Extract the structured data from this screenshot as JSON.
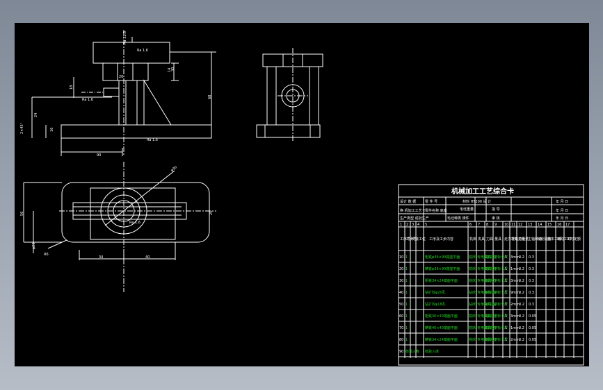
{
  "drawing": {
    "dims": {
      "top_label": "Ra 12.5",
      "ra_top": "Ra 1.6",
      "ra_left": "Ra 1.6",
      "ra_bottom": "Ra 1.6",
      "ra_plan": "Ra 1.6",
      "d30": "30",
      "d14": "14",
      "d68": "68",
      "d90": "90",
      "d24": "24",
      "d16": "16",
      "d18": "18",
      "d2x45": "2×45°",
      "phi20": "φ20",
      "phi36": "φ36",
      "r6": "R6",
      "d34": "34",
      "d40": "40",
      "d56": "56",
      "d20": "20",
      "phi": "φ"
    },
    "card": {
      "title": "机械加工工艺综合卡",
      "row1": [
        "设计 数 据",
        "零 件 号",
        "材料 HT200 设 计",
        "年 月 日"
      ],
      "row2": [
        "换 机加工工艺卡",
        "零件名称 底座",
        "毛坯重量",
        "指 导",
        "年 月 日"
      ],
      "row3": [
        "生产类型 成批生产",
        "毛坯种类 铸件",
        "审 核",
        "年 月 日"
      ],
      "col_numbers": [
        "1",
        "2",
        "3",
        "4",
        "5",
        "6",
        "7",
        "8",
        "9",
        "10",
        "11",
        "12",
        "13",
        "14",
        "15",
        "16",
        "17"
      ],
      "headers": {
        "seq": "工序号",
        "step": "工步号",
        "install": "安装工位",
        "content": "工序及工步内容",
        "machine": "机床",
        "fixture": "夹具",
        "tool": "刀具",
        "gauge": "量具",
        "passes": "走刀次数",
        "speed": "背吃刀量",
        "feed": "进给量",
        "rpm": "主轴转速",
        "cut": "切削速度",
        "time_base": "基本工时",
        "time_aux": "辅助工时",
        "quota": "工时定额"
      },
      "rows": [
        {
          "no": "10",
          "step": "1",
          "content": "粗铣φ36×90底座平面",
          "machine": "铣床",
          "fixture": "专用夹具",
          "tool": "端铣刀",
          "gauge": "游标卡尺",
          "passes": "1",
          "depth": "3mm",
          "feed": "0.2",
          "rpm": "0.3"
        },
        {
          "no": "20",
          "step": "1",
          "content": "精铣φ36×90底座平面",
          "machine": "铣床",
          "fixture": "专用夹具",
          "tool": "端铣刀",
          "gauge": "游标卡尺",
          "passes": "1",
          "depth": "1mm",
          "feed": "0.2",
          "rpm": "0.3"
        },
        {
          "no": "30",
          "step": "1",
          "content": "粗铣34×24端面平面",
          "machine": "铣床",
          "fixture": "专用夹具",
          "tool": "端铣刀",
          "gauge": "游标卡尺",
          "passes": "1",
          "depth": "3mm",
          "feed": "0.2",
          "rpm": "0.3"
        },
        {
          "no": "40",
          "step": "1",
          "content": "钻扩铰φ20孔",
          "machine": "钻床",
          "fixture": "专用夹具",
          "tool": "麻花钻",
          "gauge": "游标卡尺",
          "passes": "1",
          "depth": "9mm",
          "feed": "0.2",
          "rpm": "0.3"
        },
        {
          "no": "50",
          "step": "1",
          "content": "钻扩铰φ18孔",
          "machine": "钻床",
          "fixture": "专用夹具",
          "tool": "麻花钻",
          "gauge": "游标卡尺",
          "passes": "1",
          "depth": "2mm",
          "feed": "0.2",
          "rpm": "0.3"
        },
        {
          "no": "60",
          "step": "1",
          "content": "粗铣30×30端面平面",
          "machine": "铣床",
          "fixture": "专用夹具",
          "tool": "端铣刀",
          "gauge": "游标卡尺",
          "passes": "1",
          "depth": "3mm",
          "feed": "0.2",
          "rpm": "0.05"
        },
        {
          "no": "70",
          "step": "1",
          "content": "精铣40×40端面平面",
          "machine": "铣床",
          "fixture": "专用夹具",
          "tool": "端铣刀",
          "gauge": "游标卡尺",
          "passes": "1",
          "depth": "1mm",
          "feed": "0.2",
          "rpm": "0.05"
        },
        {
          "no": "80",
          "step": "1",
          "content": "精铣34×24端面平面",
          "machine": "铣床",
          "fixture": "专用夹具",
          "tool": "端铣刀",
          "gauge": "游标卡尺",
          "passes": "1",
          "depth": "2mm",
          "feed": "0.2",
          "rpm": "0.05"
        },
        {
          "no": "90",
          "step": "检验入库",
          "content": "检验入库"
        }
      ]
    }
  }
}
